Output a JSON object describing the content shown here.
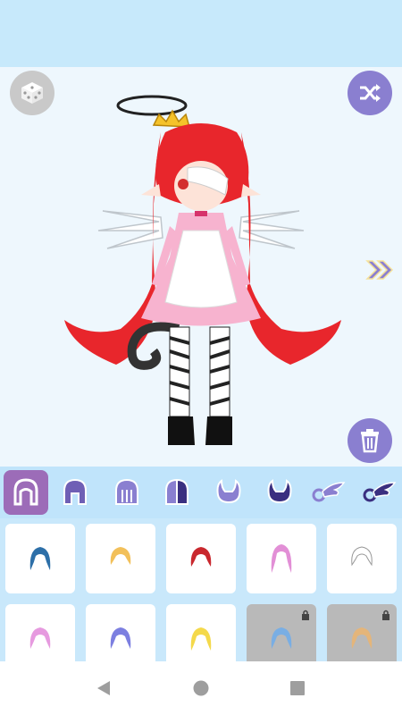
{
  "app": {
    "colors": {
      "topbar": "#c7e9fb",
      "stage": "#eef7fd",
      "accent": "#8a7fd0",
      "tab_active": "#9c6cb8",
      "tab_icon": "#6f5fb5",
      "grid_bg": "#c9e8fb",
      "locked_cell": "#b9b9b9"
    }
  },
  "buttons": {
    "random_icon": "dice-icon",
    "shuffle_icon": "shuffle-icon",
    "next_icon": "double-chevron-right-icon",
    "delete_icon": "trash-icon"
  },
  "category_tabs": [
    {
      "icon": "hair-front-icon",
      "active": true
    },
    {
      "icon": "hair-back-icon",
      "active": false
    },
    {
      "icon": "hair-bangs-icon",
      "active": false
    },
    {
      "icon": "hair-half-icon",
      "active": false
    },
    {
      "icon": "horns-icon",
      "active": false
    },
    {
      "icon": "horns-dark-icon",
      "active": false
    },
    {
      "icon": "wing-icon",
      "active": false
    },
    {
      "icon": "wing-dark-icon",
      "active": false
    }
  ],
  "hair_items": [
    {
      "color": "#2d6fa8",
      "locked": false
    },
    {
      "color": "#f2c05a",
      "locked": false
    },
    {
      "color": "#c9282e",
      "locked": false
    },
    {
      "color": "#e28fd6",
      "locked": false
    },
    {
      "color": "#ffffff",
      "locked": false
    },
    {
      "color": "#e69adf",
      "locked": false
    },
    {
      "color": "#7c7fe0",
      "locked": false
    },
    {
      "color": "#f4d94b",
      "locked": false
    },
    {
      "color": "#79aee4",
      "locked": true
    },
    {
      "color": "#e4b57a",
      "locked": true
    }
  ],
  "nav": {
    "back_icon": "back-triangle-icon",
    "home_icon": "home-circle-icon",
    "recents_icon": "recents-square-icon"
  }
}
